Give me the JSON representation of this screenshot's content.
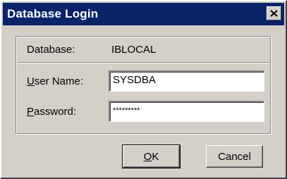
{
  "window": {
    "title": "Database Login"
  },
  "fields": {
    "database_label": "Database:",
    "database_value": "IBLOCAL",
    "username_label_mnemonic": "U",
    "username_label_rest": "ser Name:",
    "username_value": "SYSDBA",
    "password_label_mnemonic": "P",
    "password_label_rest": "assword:",
    "password_value": "*********"
  },
  "buttons": {
    "ok_mnemonic": "O",
    "ok_rest": "K",
    "cancel": "Cancel"
  },
  "icons": {
    "close": "close-icon"
  },
  "colors": {
    "titlebar": "#0a246a",
    "face": "#d4d0c8"
  }
}
